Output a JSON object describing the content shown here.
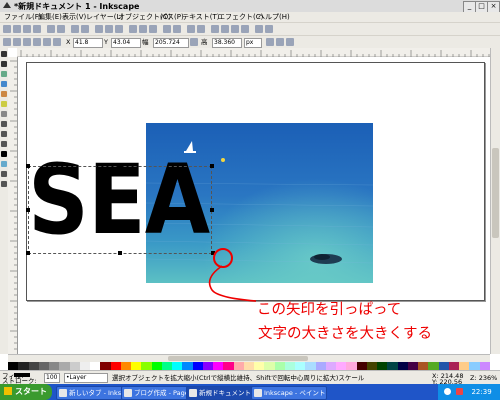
{
  "window": {
    "title": "*新規ドキュメント 1 - Inkscape",
    "min": "_",
    "max": "□",
    "close": "×"
  },
  "menu": [
    "ファイル(F)",
    "編集(E)",
    "表示(V)",
    "レイヤー(L)",
    "オブジェクト(O)",
    "パス(P)",
    "テキスト(T)",
    "エフェクト(C)",
    "ヘルプ(H)"
  ],
  "toolbar2": {
    "x_label": "X",
    "x_value": "41.8",
    "y_label": "Y",
    "y_value": "43.04",
    "w_label": "幅",
    "w_value": "205.724",
    "h_label": "高",
    "h_value": "38.360",
    "unit": "px"
  },
  "canvas": {
    "headline": "SEA",
    "note_line1": "この矢印を引っぱって",
    "note_line2": "文字の大きさを大きくする"
  },
  "status": {
    "fill_label": "フィル:",
    "stroke_label": "ストローク:",
    "opacity": "100",
    "layer": "•Layer",
    "message": "選択オブジェクトを拡大縮小(Ctrlで縦横比維持、Shiftで回転中心周りに拡大)スケール",
    "coords_x": "X: 214.48",
    "coords_y": "Y: 220.56",
    "zoom": "Z: 236%"
  },
  "taskbar": {
    "start": "スタート",
    "tasks": [
      "新しいタブ - Inkscape 情報",
      "ブログ作成 - Page",
      "新規ドキュメント",
      "Inkscape - ペイント"
    ],
    "clock": "22:39"
  },
  "colors": {
    "accent_red": "#e00000",
    "taskbar_blue": "#1f55c8",
    "start_green": "#3a9a2e"
  }
}
